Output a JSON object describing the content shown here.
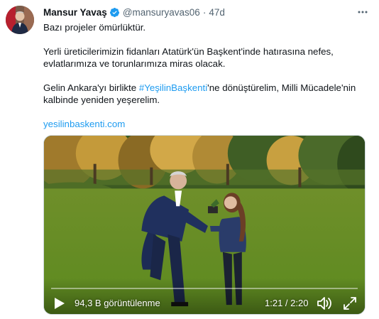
{
  "tweet": {
    "author": {
      "name": "Mansur Yavaş",
      "handle": "@mansuryavas06",
      "verified": true,
      "avatar_icon": "profile-photo"
    },
    "separator": "·",
    "time": "47d",
    "more_icon": "more-horizontal-icon",
    "text": {
      "line1": "Bazı projeler ömürlüktür.",
      "line2": "Yerli üreticilerimizin fidanları Atatürk'ün Başkent'inde hatırasına nefes,",
      "line3": "evlatlarımıza ve torunlarımıza miras olacak.",
      "line4_before": "Gelin Ankara'yı birlikte ",
      "hashtag": "#YeşilinBaşkenti",
      "line4_after": "'ne dönüştürelim, Milli Mücadele'nin",
      "line5": "kalbinde yeniden yeşerelim.",
      "link": "yesilinbaskenti.com"
    },
    "video": {
      "views": "94,3 B görüntülenme",
      "timecode": "1:21 / 2:20",
      "progress": 0.0,
      "play_icon": "play-icon",
      "volume_icon": "volume-icon",
      "fullscreen_icon": "fullscreen-icon"
    },
    "colors": {
      "link": "#1d9bf0",
      "text": "#0f1419",
      "secondary": "#536471",
      "verified": "#1d9bf0"
    }
  }
}
